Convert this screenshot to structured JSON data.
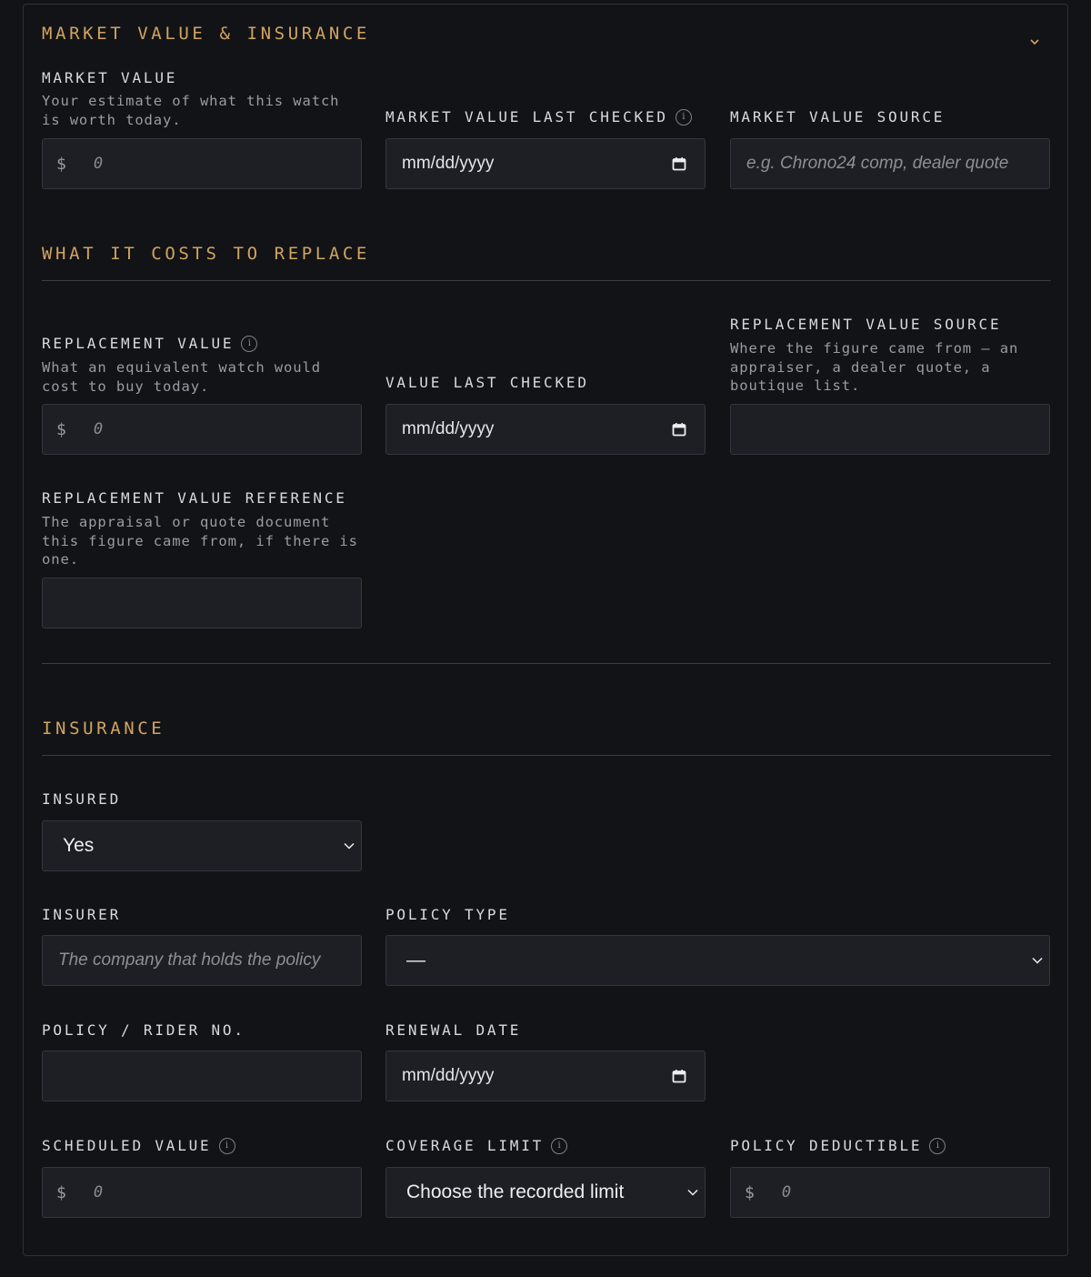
{
  "section": {
    "title": "MARKET VALUE & INSURANCE",
    "collapse_icon": "chevron-down-icon"
  },
  "market": {
    "value_label": "MARKET VALUE",
    "value_help": "Your estimate of what this watch is worth today.",
    "currency_symbol": "$",
    "value_placeholder": "0",
    "last_checked_label": "MARKET VALUE LAST CHECKED",
    "last_checked_value": "mm/dd/yyyy",
    "source_label": "MARKET VALUE SOURCE",
    "source_placeholder": "e.g. Chrono24 comp, dealer quote"
  },
  "replace": {
    "heading": "WHAT IT COSTS TO REPLACE",
    "value_label": "REPLACEMENT VALUE",
    "value_help": "What an equivalent watch would cost to buy today.",
    "currency_symbol": "$",
    "value_placeholder": "0",
    "last_checked_label": "VALUE LAST CHECKED",
    "last_checked_value": "mm/dd/yyyy",
    "source_label": "REPLACEMENT VALUE SOURCE",
    "source_help": "Where the figure came from — an appraiser, a dealer quote, a boutique list.",
    "source_value": "",
    "reference_label": "REPLACEMENT VALUE REFERENCE",
    "reference_help": "The appraisal or quote document this figure came from, if there is one.",
    "reference_value": ""
  },
  "insurance": {
    "heading": "INSURANCE",
    "insured_label": "INSURED",
    "insured_value": "Yes",
    "insurer_label": "INSURER",
    "insurer_placeholder": "The company that holds the policy",
    "policy_type_label": "POLICY TYPE",
    "policy_type_value": "—",
    "policy_no_label": "POLICY / RIDER NO.",
    "policy_no_value": "",
    "renewal_label": "RENEWAL DATE",
    "renewal_value": "mm/dd/yyyy",
    "scheduled_label": "SCHEDULED VALUE",
    "scheduled_placeholder": "0",
    "coverage_label": "COVERAGE LIMIT",
    "coverage_value": "Choose the recorded limit",
    "deductible_label": "POLICY DEDUCTIBLE",
    "deductible_placeholder": "0",
    "currency_symbol": "$"
  },
  "colors": {
    "accent": "#d1a460",
    "background": "#121317",
    "field_bg": "#1d1f25"
  }
}
